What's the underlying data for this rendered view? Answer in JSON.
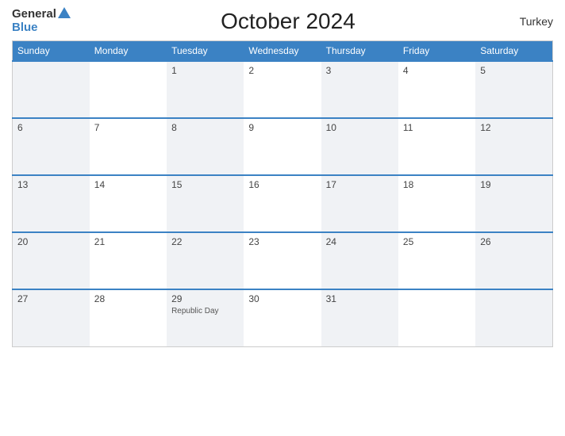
{
  "header": {
    "logo_general": "General",
    "logo_blue": "Blue",
    "title": "October 2024",
    "country": "Turkey"
  },
  "calendar": {
    "days_of_week": [
      "Sunday",
      "Monday",
      "Tuesday",
      "Wednesday",
      "Thursday",
      "Friday",
      "Saturday"
    ],
    "weeks": [
      [
        {
          "num": "",
          "event": ""
        },
        {
          "num": "",
          "event": ""
        },
        {
          "num": "1",
          "event": ""
        },
        {
          "num": "2",
          "event": ""
        },
        {
          "num": "3",
          "event": ""
        },
        {
          "num": "4",
          "event": ""
        },
        {
          "num": "5",
          "event": ""
        }
      ],
      [
        {
          "num": "6",
          "event": ""
        },
        {
          "num": "7",
          "event": ""
        },
        {
          "num": "8",
          "event": ""
        },
        {
          "num": "9",
          "event": ""
        },
        {
          "num": "10",
          "event": ""
        },
        {
          "num": "11",
          "event": ""
        },
        {
          "num": "12",
          "event": ""
        }
      ],
      [
        {
          "num": "13",
          "event": ""
        },
        {
          "num": "14",
          "event": ""
        },
        {
          "num": "15",
          "event": ""
        },
        {
          "num": "16",
          "event": ""
        },
        {
          "num": "17",
          "event": ""
        },
        {
          "num": "18",
          "event": ""
        },
        {
          "num": "19",
          "event": ""
        }
      ],
      [
        {
          "num": "20",
          "event": ""
        },
        {
          "num": "21",
          "event": ""
        },
        {
          "num": "22",
          "event": ""
        },
        {
          "num": "23",
          "event": ""
        },
        {
          "num": "24",
          "event": ""
        },
        {
          "num": "25",
          "event": ""
        },
        {
          "num": "26",
          "event": ""
        }
      ],
      [
        {
          "num": "27",
          "event": ""
        },
        {
          "num": "28",
          "event": ""
        },
        {
          "num": "29",
          "event": "Republic Day"
        },
        {
          "num": "30",
          "event": ""
        },
        {
          "num": "31",
          "event": ""
        },
        {
          "num": "",
          "event": ""
        },
        {
          "num": "",
          "event": ""
        }
      ]
    ]
  }
}
